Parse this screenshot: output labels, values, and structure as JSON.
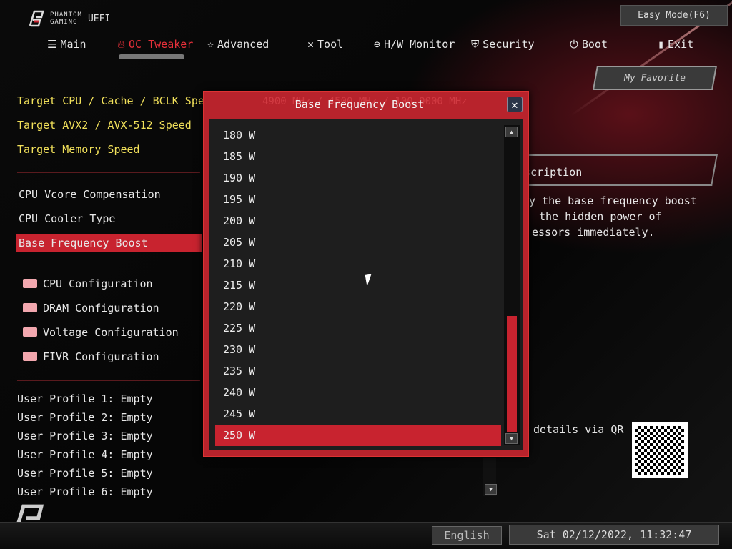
{
  "header": {
    "brand_line1": "PHANTOM",
    "brand_line2": "GAMING",
    "uefi": "UEFI",
    "easy_mode": "Easy Mode(F6)",
    "my_favorite": "My Favorite"
  },
  "nav": [
    {
      "label": "Main",
      "icon": "list-icon"
    },
    {
      "label": "OC Tweaker",
      "icon": "flame-icon",
      "active": true
    },
    {
      "label": "Advanced",
      "icon": "star-icon"
    },
    {
      "label": "Tool",
      "icon": "tools-icon"
    },
    {
      "label": "H/W Monitor",
      "icon": "monitor-icon"
    },
    {
      "label": "Security",
      "icon": "shield-icon"
    },
    {
      "label": "Boot",
      "icon": "power-icon"
    },
    {
      "label": "Exit",
      "icon": "exit-icon"
    }
  ],
  "menu": {
    "targets": [
      "Target CPU / Cache / BCLK Speed",
      "Target AVX2 / AVX-512 Speed",
      "Target Memory Speed"
    ],
    "settings": [
      "CPU Vcore Compensation",
      "CPU Cooler Type",
      "Base Frequency Boost"
    ],
    "folders": [
      "CPU Configuration",
      "DRAM Configuration",
      "Voltage Configuration",
      "FIVR Configuration"
    ],
    "profiles": [
      "User Profile 1: Empty",
      "User Profile 2: Empty",
      "User Profile 3: Empty",
      "User Profile 4: Empty",
      "User Profile 5: Empty",
      "User Profile 6: Empty"
    ]
  },
  "background_value": "4900 MHz / 4500 MHz / 100.0000 MHz",
  "description": {
    "title": "scription",
    "lines": [
      "y the base frequency boost",
      "the hidden power of",
      "essors immediately."
    ],
    "qr_text": "details via QR"
  },
  "dialog": {
    "title": "Base Frequency Boost",
    "options": [
      "180 W",
      "185 W",
      "190 W",
      "195 W",
      "200 W",
      "205 W",
      "210 W",
      "215 W",
      "220 W",
      "225 W",
      "230 W",
      "235 W",
      "240 W",
      "245 W",
      "250 W"
    ],
    "selected": "250 W",
    "scroll_position": 1.0
  },
  "footer": {
    "language": "English",
    "datetime": "Sat 02/12/2022, 11:32:47"
  },
  "colors": {
    "accent": "#c8232f",
    "highlight_text": "#f1e05a"
  }
}
